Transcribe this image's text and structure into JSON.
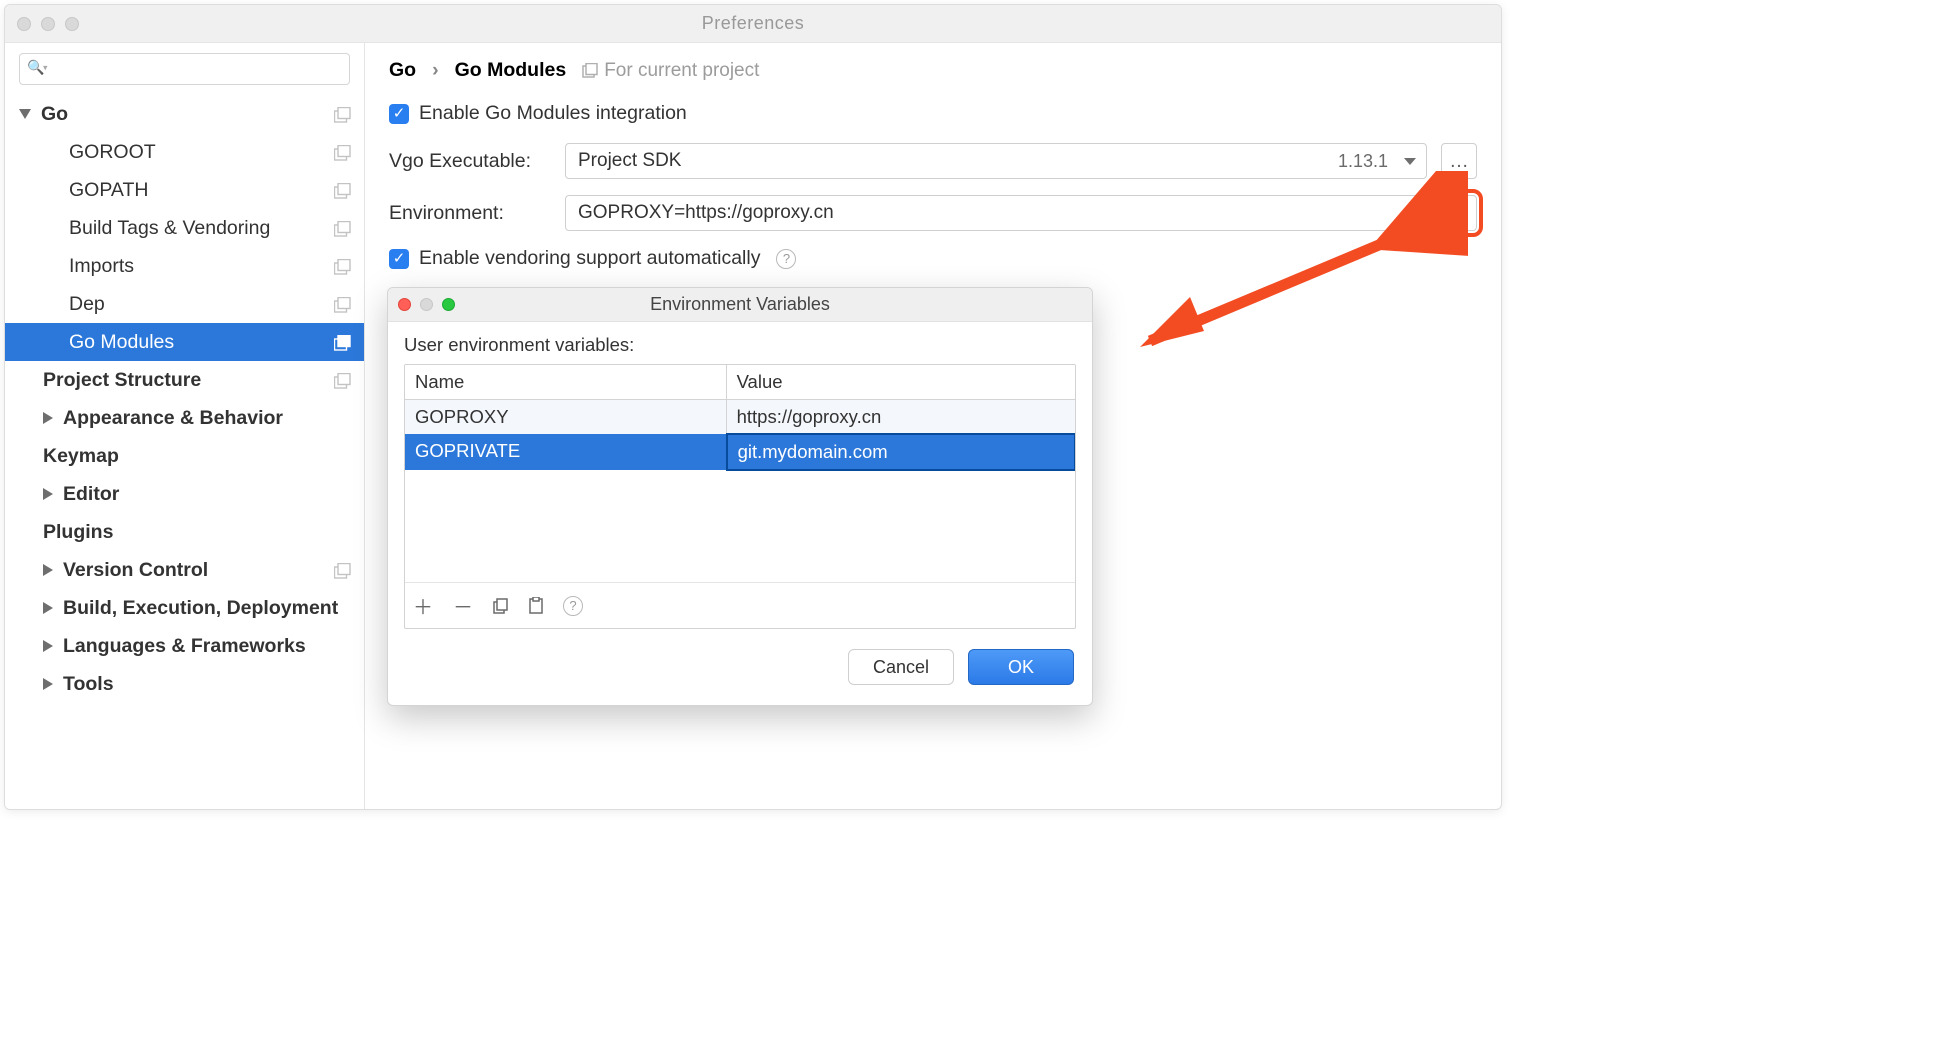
{
  "window": {
    "title": "Preferences"
  },
  "sidebar": {
    "search_placeholder": "",
    "items": [
      {
        "label": "Go",
        "level": 0,
        "bold": true,
        "caret": "down",
        "proj": true
      },
      {
        "label": "GOROOT",
        "level": 1,
        "proj": true
      },
      {
        "label": "GOPATH",
        "level": 1,
        "proj": true
      },
      {
        "label": "Build Tags & Vendoring",
        "level": 1,
        "proj": true
      },
      {
        "label": "Imports",
        "level": 1,
        "proj": true
      },
      {
        "label": "Dep",
        "level": 1,
        "proj": true
      },
      {
        "label": "Go Modules",
        "level": 1,
        "proj": true,
        "selected": true
      },
      {
        "label": "Project Structure",
        "level": "0b",
        "bold": true,
        "proj": true
      },
      {
        "label": "Appearance & Behavior",
        "level": "0b",
        "bold": true,
        "caret": "right"
      },
      {
        "label": "Keymap",
        "level": "0b",
        "bold": true
      },
      {
        "label": "Editor",
        "level": "0b",
        "bold": true,
        "caret": "right"
      },
      {
        "label": "Plugins",
        "level": "0b",
        "bold": true
      },
      {
        "label": "Version Control",
        "level": "0b",
        "bold": true,
        "caret": "right",
        "proj": true
      },
      {
        "label": "Build, Execution, Deployment",
        "level": "0b",
        "bold": true,
        "caret": "right"
      },
      {
        "label": "Languages & Frameworks",
        "level": "0b",
        "bold": true,
        "caret": "right"
      },
      {
        "label": "Tools",
        "level": "0b",
        "bold": true,
        "caret": "right"
      }
    ]
  },
  "breadcrumb": {
    "a": "Go",
    "b": "Go Modules",
    "scope": "For current project"
  },
  "form": {
    "enable_modules": "Enable Go Modules integration",
    "vgo_label": "Vgo Executable:",
    "vgo_value": "Project SDK",
    "vgo_version": "1.13.1",
    "browse_label": "…",
    "env_label": "Environment:",
    "env_value": "GOPROXY=https://goproxy.cn",
    "enable_vendoring": "Enable vendoring support automatically"
  },
  "dialog": {
    "title": "Environment Variables",
    "section": "User environment variables:",
    "col_name": "Name",
    "col_value": "Value",
    "row1_name": "GOPROXY",
    "row1_value": "https://goproxy.cn",
    "row2_name": "GOPRIVATE",
    "row2_value": "git.mydomain.com",
    "cancel": "Cancel",
    "ok": "OK"
  }
}
